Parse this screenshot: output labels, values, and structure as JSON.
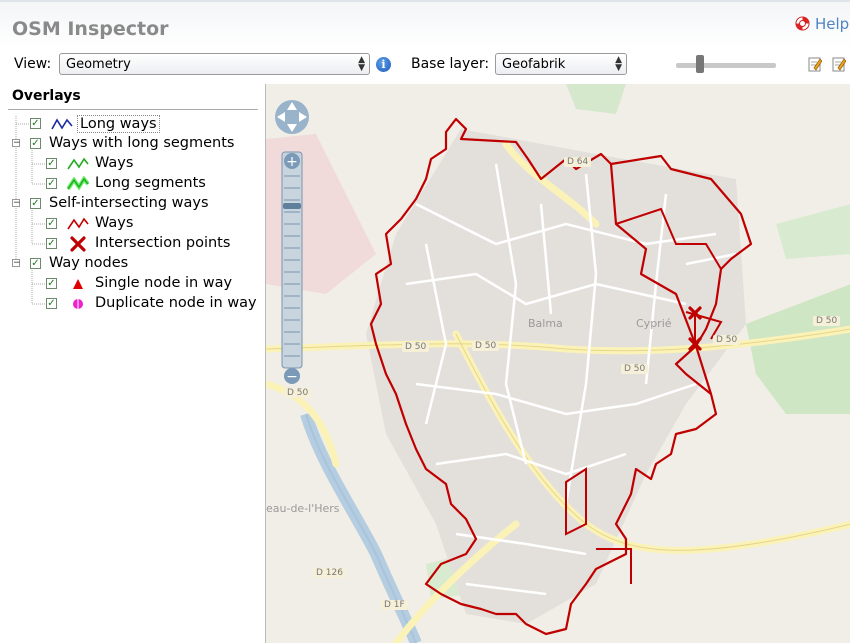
{
  "app": {
    "title": "OSM Inspector",
    "help_label": "Help"
  },
  "toolbar": {
    "view_label": "View:",
    "view_value": "Geometry",
    "base_layer_label": "Base layer:",
    "base_layer_value": "Geofabrik",
    "opacity_level": 0.22
  },
  "overlays": {
    "title": "Overlays",
    "items": [
      {
        "label": "Long ways",
        "checked": true,
        "icon": "long-way-line-icon"
      },
      {
        "label": "Ways with long segments",
        "checked": true,
        "expanded": true,
        "children": [
          {
            "label": "Ways",
            "checked": true,
            "icon": "green-line-icon"
          },
          {
            "label": "Long segments",
            "checked": true,
            "icon": "long-segment-line-icon"
          }
        ]
      },
      {
        "label": "Self-intersecting ways",
        "checked": true,
        "expanded": true,
        "children": [
          {
            "label": "Ways",
            "checked": true,
            "icon": "red-line-icon"
          },
          {
            "label": "Intersection points",
            "checked": true,
            "icon": "red-x-icon"
          }
        ]
      },
      {
        "label": "Way nodes",
        "checked": true,
        "expanded": true,
        "children": [
          {
            "label": "Single node in way",
            "checked": true,
            "icon": "red-triangle-icon"
          },
          {
            "label": "Duplicate node in way",
            "checked": true,
            "icon": "magenta-circle-icon"
          }
        ]
      }
    ]
  },
  "map": {
    "place_labels": [
      "Balma",
      "Cyprié",
      "eau-de-l'Hers"
    ],
    "road_labels": [
      "D 64",
      "D 50",
      "D 50",
      "D 50",
      "D 50",
      "D 50",
      "D 50",
      "D 126",
      "D 1F"
    ],
    "colors": {
      "self_intersecting_way": "#c00000",
      "intersection_point": "#c00000"
    }
  }
}
